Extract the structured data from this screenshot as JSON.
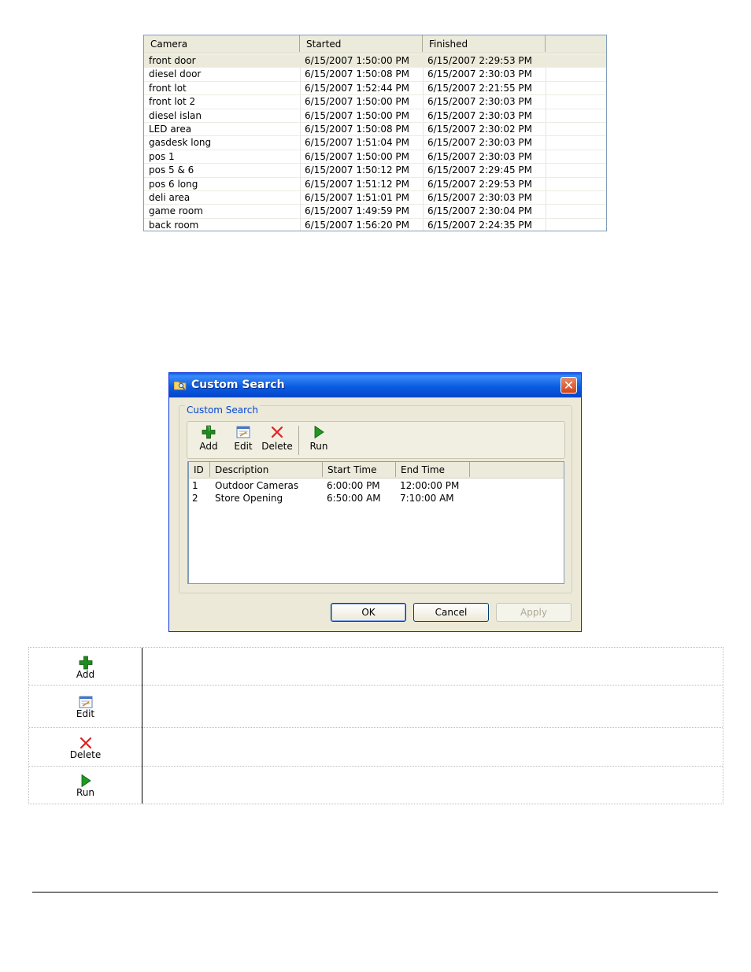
{
  "camera_list": {
    "columns": [
      "Camera",
      "Started",
      "Finished"
    ],
    "rows": [
      {
        "camera": "front door",
        "started": "6/15/2007 1:50:00 PM",
        "finished": "6/15/2007 2:29:53 PM"
      },
      {
        "camera": "diesel door",
        "started": "6/15/2007 1:50:08 PM",
        "finished": "6/15/2007 2:30:03 PM"
      },
      {
        "camera": "front lot",
        "started": "6/15/2007 1:52:44 PM",
        "finished": "6/15/2007 2:21:55 PM"
      },
      {
        "camera": "front lot 2",
        "started": "6/15/2007 1:50:00 PM",
        "finished": "6/15/2007 2:30:03 PM"
      },
      {
        "camera": "diesel islan",
        "started": "6/15/2007 1:50:00 PM",
        "finished": "6/15/2007 2:30:03 PM"
      },
      {
        "camera": "LED area",
        "started": "6/15/2007 1:50:08 PM",
        "finished": "6/15/2007 2:30:02 PM"
      },
      {
        "camera": "gasdesk long",
        "started": "6/15/2007 1:51:04 PM",
        "finished": "6/15/2007 2:30:03 PM"
      },
      {
        "camera": "pos 1",
        "started": "6/15/2007 1:50:00 PM",
        "finished": "6/15/2007 2:30:03 PM"
      },
      {
        "camera": "pos 5 & 6",
        "started": "6/15/2007 1:50:12 PM",
        "finished": "6/15/2007 2:29:45 PM"
      },
      {
        "camera": "pos 6 long",
        "started": "6/15/2007 1:51:12 PM",
        "finished": "6/15/2007 2:29:53 PM"
      },
      {
        "camera": "deli area",
        "started": "6/15/2007 1:51:01 PM",
        "finished": "6/15/2007 2:30:03 PM"
      },
      {
        "camera": "game room",
        "started": "6/15/2007 1:49:59 PM",
        "finished": "6/15/2007 2:30:04 PM"
      },
      {
        "camera": "back room",
        "started": "6/15/2007 1:56:20 PM",
        "finished": "6/15/2007 2:24:35 PM"
      }
    ]
  },
  "dialog": {
    "title": "Custom Search",
    "close_glyph": "✕",
    "group_label": "Custom Search",
    "toolbar": {
      "add": "Add",
      "edit": "Edit",
      "delete": "Delete",
      "run": "Run"
    },
    "list": {
      "columns": [
        "ID",
        "Description",
        "Start Time",
        "End Time"
      ],
      "rows": [
        {
          "id": "1",
          "description": "Outdoor Cameras",
          "start": "6:00:00 PM",
          "end": "12:00:00 PM"
        },
        {
          "id": "2",
          "description": "Store Opening",
          "start": "6:50:00 AM",
          "end": "7:10:00 AM"
        }
      ]
    },
    "buttons": {
      "ok": "OK",
      "cancel": "Cancel",
      "apply": "Apply"
    }
  },
  "legend": {
    "items": [
      {
        "icon": "add-icon",
        "label": "Add"
      },
      {
        "icon": "edit-icon",
        "label": "Edit"
      },
      {
        "icon": "delete-icon",
        "label": "Delete"
      },
      {
        "icon": "run-icon",
        "label": "Run"
      }
    ]
  },
  "colors": {
    "titlebar": "#0b5ce3",
    "dialog_bg": "#ece9d8",
    "add_green": "#1f8a1f",
    "delete_red": "#e02020",
    "run_green": "#1e9a1e",
    "group_label": "#0046d5"
  }
}
